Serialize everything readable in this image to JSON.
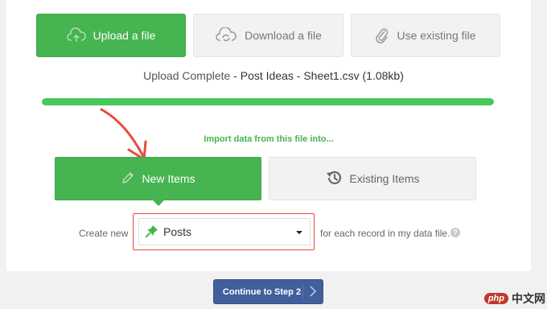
{
  "import_methods": {
    "upload_label": "Upload a file",
    "download_label": "Download a file",
    "existing_label": "Use existing file"
  },
  "upload_status": {
    "status_text": "Upload Complete",
    "separator": " - ",
    "file_name": "Post Ideas - Sheet1.csv",
    "file_size": "(1.08kb)",
    "progress_percent": 100
  },
  "import_target": {
    "heading": "Import data from this file into...",
    "new_items_label": "New Items",
    "existing_items_label": "Existing Items",
    "selected": "New Items"
  },
  "create_new": {
    "prefix_label": "Create new",
    "post_type_value": "Posts",
    "suffix_label": "for each record in my data file.",
    "help_glyph": "?"
  },
  "footer": {
    "continue_label": "Continue to Step 2"
  },
  "watermark": {
    "logo_text": "php",
    "site_text": "中文网"
  },
  "colors": {
    "accent_green": "#46b450",
    "annotation_red": "#e74c3c",
    "continue_blue": "#425f9c"
  }
}
